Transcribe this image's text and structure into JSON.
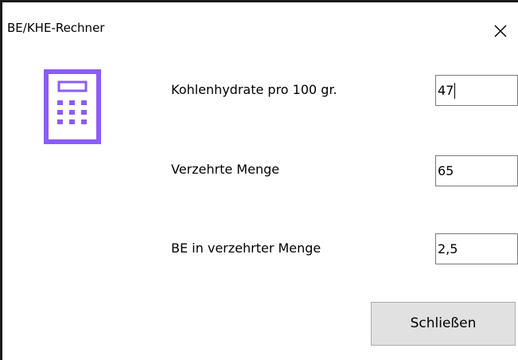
{
  "window": {
    "title": "BE/KHE-Rechner"
  },
  "icons": {
    "close": "close-icon",
    "calculator": "calculator-icon"
  },
  "colors": {
    "icon_accent": "#8b5cf6"
  },
  "fields": [
    {
      "label": "Kohlenhydrate pro 100 gr.",
      "value": "47"
    },
    {
      "label": "Verzehrte Menge",
      "value": "65"
    },
    {
      "label": "BE in verzehrter Menge",
      "value": "2,5"
    }
  ],
  "buttons": {
    "close_label": "Schließen"
  }
}
